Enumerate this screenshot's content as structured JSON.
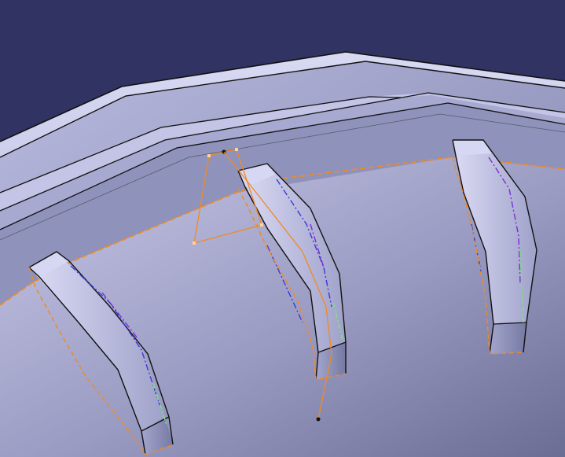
{
  "viewport": {
    "background_color": "#313363",
    "floor_color_light": "#c9cae8",
    "floor_color_dark": "#6c6f97",
    "edge_color": "#111111",
    "selection_color": "#f08a24",
    "axis_color_blue": "#3a3ad8",
    "axis_color_purple": "#7a2fd0",
    "axis_color_green": "#7de07d"
  },
  "scene": {
    "objects": [
      "rim-bands",
      "floor-surface",
      "blade-left",
      "blade-middle",
      "blade-right",
      "sketch-polygon",
      "guide-line"
    ]
  }
}
